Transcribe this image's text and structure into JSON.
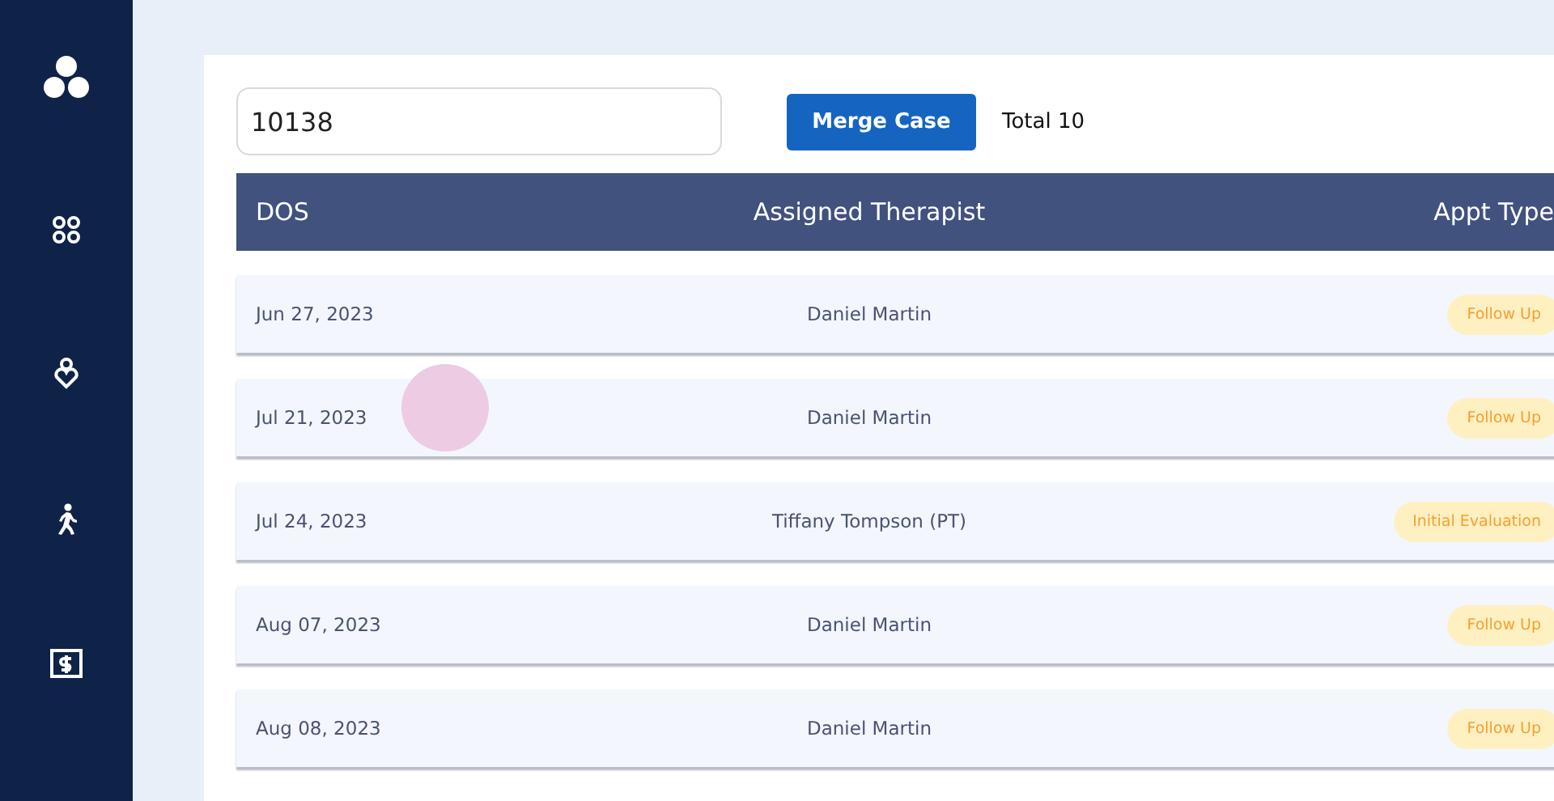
{
  "search": {
    "value": "10138"
  },
  "merge_button": "Merge Case",
  "total": "Total 10",
  "table": {
    "columns": [
      "DOS",
      "Assigned Therapist",
      "Appt Type"
    ],
    "rows": [
      {
        "dos": "Jun 27, 2023",
        "therapist": "Daniel Martin",
        "appt_type": "Follow Up"
      },
      {
        "dos": "Jul 21, 2023",
        "therapist": "Daniel Martin",
        "appt_type": "Follow Up"
      },
      {
        "dos": "Jul 24, 2023",
        "therapist": "Tiffany Tompson (PT)",
        "appt_type": "Initial Evaluation"
      },
      {
        "dos": "Aug 07, 2023",
        "therapist": "Daniel Martin",
        "appt_type": "Follow Up"
      },
      {
        "dos": "Aug 08, 2023",
        "therapist": "Daniel Martin",
        "appt_type": "Follow Up"
      }
    ]
  }
}
